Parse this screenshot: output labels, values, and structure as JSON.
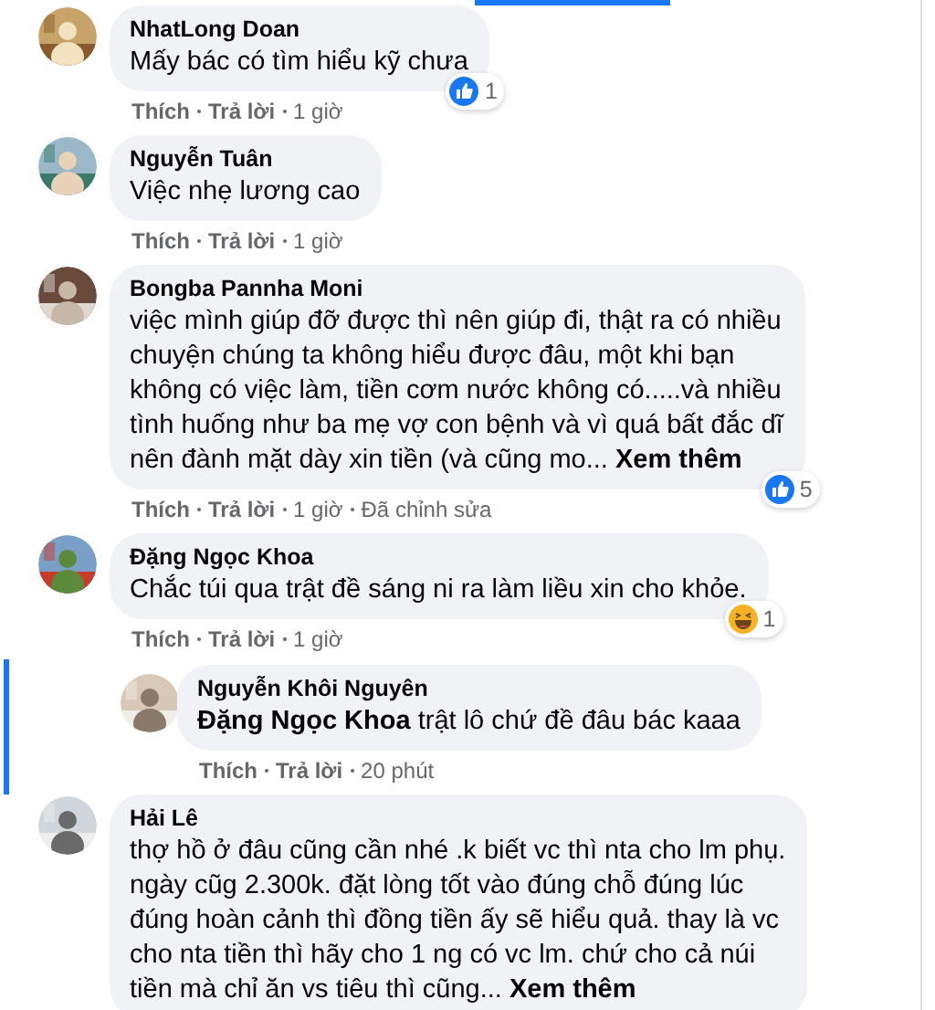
{
  "comments": [
    {
      "author": "NhatLong Doan",
      "text": "Mấy bác có tìm hiểu kỹ chưa",
      "reaction": {
        "kind": "like",
        "count": "1"
      },
      "actions": [
        "Thích",
        "Trả lời",
        "1 giờ"
      ]
    },
    {
      "author": "Nguyễn Tuân",
      "text": "Việc nhẹ lương cao",
      "actions": [
        "Thích",
        "Trả lời",
        "1 giờ"
      ]
    },
    {
      "author": "Bongba Pannha Moni",
      "text": "việc mình giúp đỡ được thì nên giúp đi, thật ra có nhiều\nchuyện chúng ta không hiểu được đâu, một khi bạn\nkhông có việc làm, tiền cơm nước không có.....và nhiều\ntình huống như ba mẹ vợ con bệnh và vì quá bất đắc dĩ\nnên đành mặt dày xin tiền (và cũng mo...",
      "see_more": "Xem thêm",
      "reaction": {
        "kind": "like",
        "count": "5"
      },
      "actions": [
        "Thích",
        "Trả lời",
        "1 giờ",
        "Đã chỉnh sửa"
      ]
    },
    {
      "author": "Đặng Ngọc Khoa",
      "text": "Chắc túi qua trật đề sáng ni ra làm liều xin cho khỏe.",
      "reaction": {
        "kind": "haha",
        "count": "1"
      },
      "actions": [
        "Thích",
        "Trả lời",
        "1 giờ"
      ],
      "replies": [
        {
          "author": "Nguyễn Khôi Nguyên",
          "text": "**Đặng Ngọc Khoa** trật lô chứ đề đâu bác kaaa",
          "actions": [
            "Thích",
            "Trả lời",
            "20 phút"
          ]
        }
      ]
    },
    {
      "author": "Hải Lê",
      "text": "thợ hồ ở đâu cũng cần nhé .k biết vc thì nta cho lm phụ.\nngày cũg 2.300k. đặt lòng tốt vào đúng chỗ đúng lúc\nđúng hoàn cảnh thì đồng tiền ấy sẽ hiểu quả. thay là vc\ncho nta tiền thì hãy cho 1 ng có vc lm. chứ cho cả núi\ntiền mà chỉ ăn vs tiêu thì cũng...",
      "see_more": "Xem thêm"
    }
  ]
}
